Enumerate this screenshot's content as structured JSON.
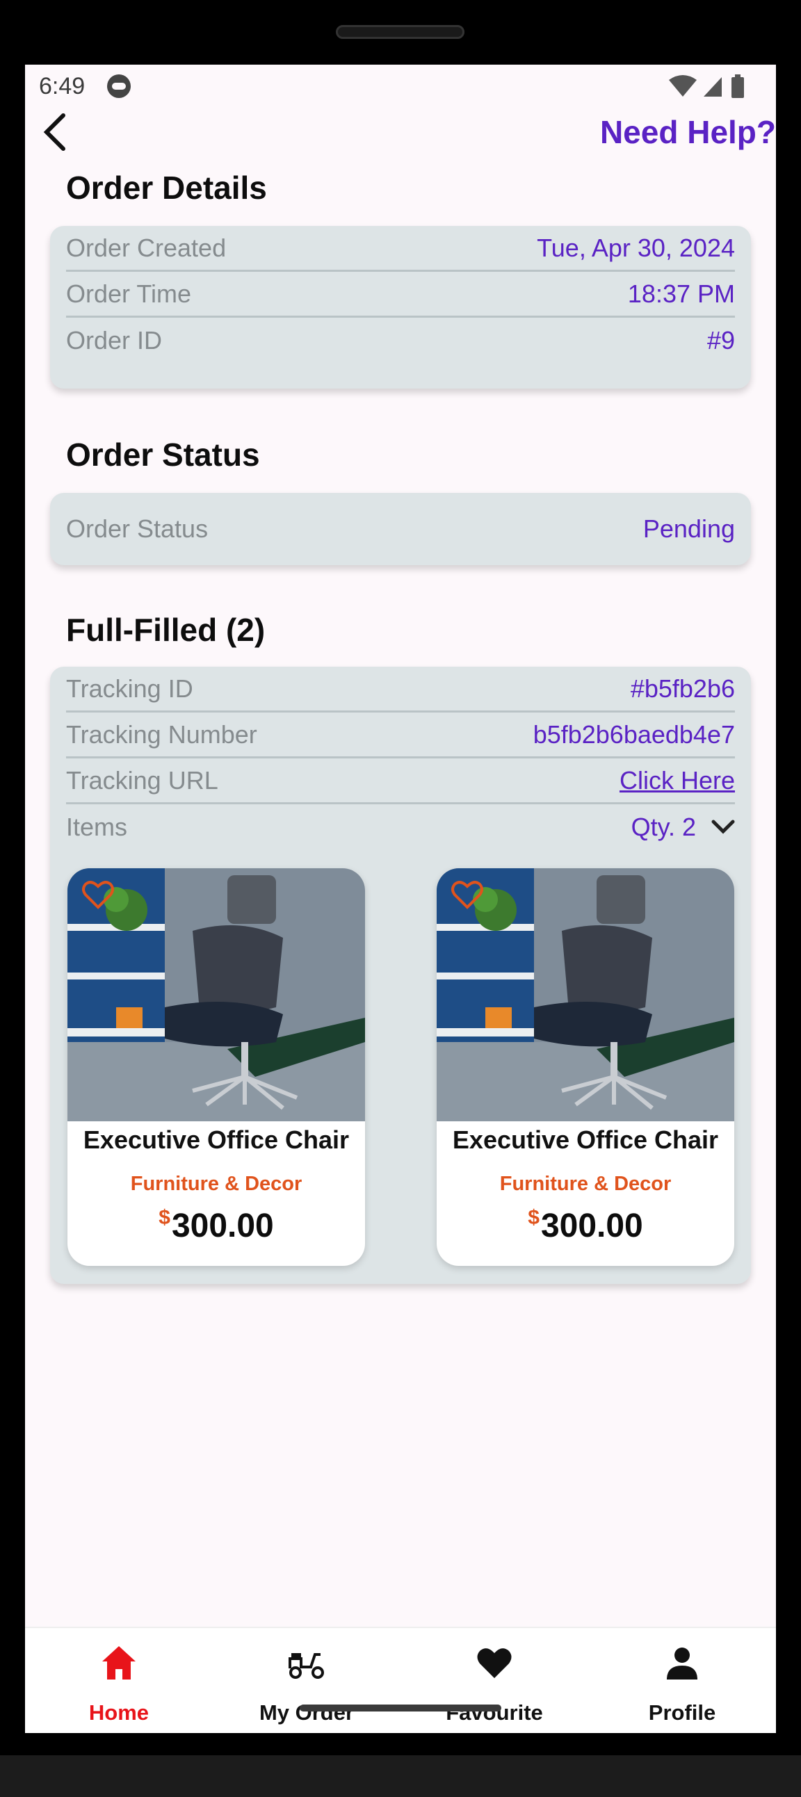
{
  "status_bar": {
    "time": "6:49"
  },
  "header": {
    "help_label": "Need Help?"
  },
  "order_details": {
    "title": "Order Details",
    "rows": [
      {
        "label": "Order Created",
        "value": "Tue, Apr 30, 2024"
      },
      {
        "label": "Order Time",
        "value": "18:37 PM"
      },
      {
        "label": "Order ID",
        "value": "#9"
      }
    ]
  },
  "order_status": {
    "title": "Order Status",
    "label": "Order Status",
    "value": "Pending"
  },
  "fulfilled": {
    "title": "Full-Filled (2)",
    "rows": [
      {
        "label": "Tracking ID",
        "value": "#b5fb2b6"
      },
      {
        "label": "Tracking Number",
        "value": "b5fb2b6baedb4e7"
      },
      {
        "label": "Tracking URL",
        "value": "Click Here"
      }
    ],
    "items_label": "Items",
    "qty_label": "Qty. 2",
    "products": [
      {
        "name": "Executive Office Chair",
        "category": "Furniture & Decor",
        "currency": "$",
        "price": "300.00"
      },
      {
        "name": "Executive Office Chair",
        "category": "Furniture & Decor",
        "currency": "$",
        "price": "300.00"
      }
    ]
  },
  "bottom_nav": {
    "items": [
      {
        "label": "Home",
        "icon": "home-icon",
        "active": true
      },
      {
        "label": "My Order",
        "icon": "scooter-icon",
        "active": false
      },
      {
        "label": "Favourite",
        "icon": "heart-icon",
        "active": false
      },
      {
        "label": "Profile",
        "icon": "person-icon",
        "active": false
      }
    ]
  },
  "colors": {
    "accent": "#5a22c4",
    "active_nav": "#e8141a",
    "category": "#e0531c",
    "card_bg": "#dde4e6"
  }
}
